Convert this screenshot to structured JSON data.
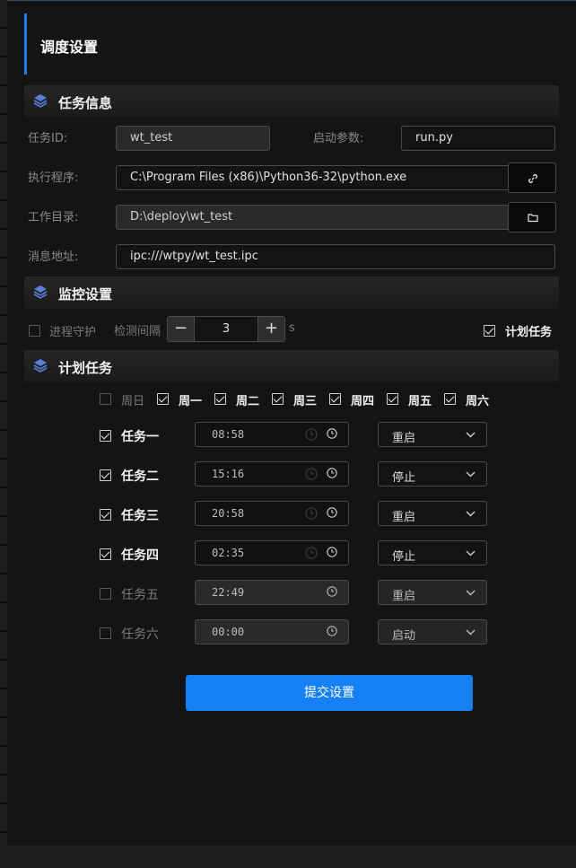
{
  "page_title": "调度设置",
  "sections": {
    "task_info": "任务信息",
    "monitor": "监控设置",
    "schedule": "计划任务"
  },
  "task_info": {
    "task_id_label": "任务ID:",
    "task_id_value": "wt_test",
    "start_params_label": "启动参数:",
    "start_params_value": "run.py",
    "exec_label": "执行程序:",
    "exec_value": "C:\\Program Files (x86)\\Python36-32\\python.exe",
    "workdir_label": "工作目录:",
    "workdir_value": "D:\\deploy\\wt_test",
    "msg_label": "消息地址:",
    "msg_value": "ipc:///wtpy/wt_test.ipc"
  },
  "monitor": {
    "guard_label": "进程守护",
    "guard_checked": false,
    "interval_label": "检测间隔",
    "interval_value": "3",
    "unit": "s",
    "schedule_label": "计划任务",
    "schedule_checked": true
  },
  "weekdays": [
    {
      "label": "周日",
      "checked": false
    },
    {
      "label": "周一",
      "checked": true
    },
    {
      "label": "周二",
      "checked": true
    },
    {
      "label": "周三",
      "checked": true
    },
    {
      "label": "周四",
      "checked": true
    },
    {
      "label": "周五",
      "checked": true
    },
    {
      "label": "周六",
      "checked": true
    }
  ],
  "tasks": [
    {
      "label": "任务一",
      "checked": true,
      "time": "08:58",
      "action": "重启"
    },
    {
      "label": "任务二",
      "checked": true,
      "time": "15:16",
      "action": "停止"
    },
    {
      "label": "任务三",
      "checked": true,
      "time": "20:58",
      "action": "重启"
    },
    {
      "label": "任务四",
      "checked": true,
      "time": "02:35",
      "action": "停止"
    },
    {
      "label": "任务五",
      "checked": false,
      "time": "22:49",
      "action": "重启"
    },
    {
      "label": "任务六",
      "checked": false,
      "time": "00:00",
      "action": "启动"
    }
  ],
  "submit_label": "提交设置",
  "colors": {
    "accent": "#1581f5",
    "background": "#141414"
  },
  "icons": [
    "layers-icon",
    "link-icon",
    "folder-icon",
    "clock-icon",
    "chevron-down-icon",
    "minus-icon",
    "plus-icon"
  ]
}
